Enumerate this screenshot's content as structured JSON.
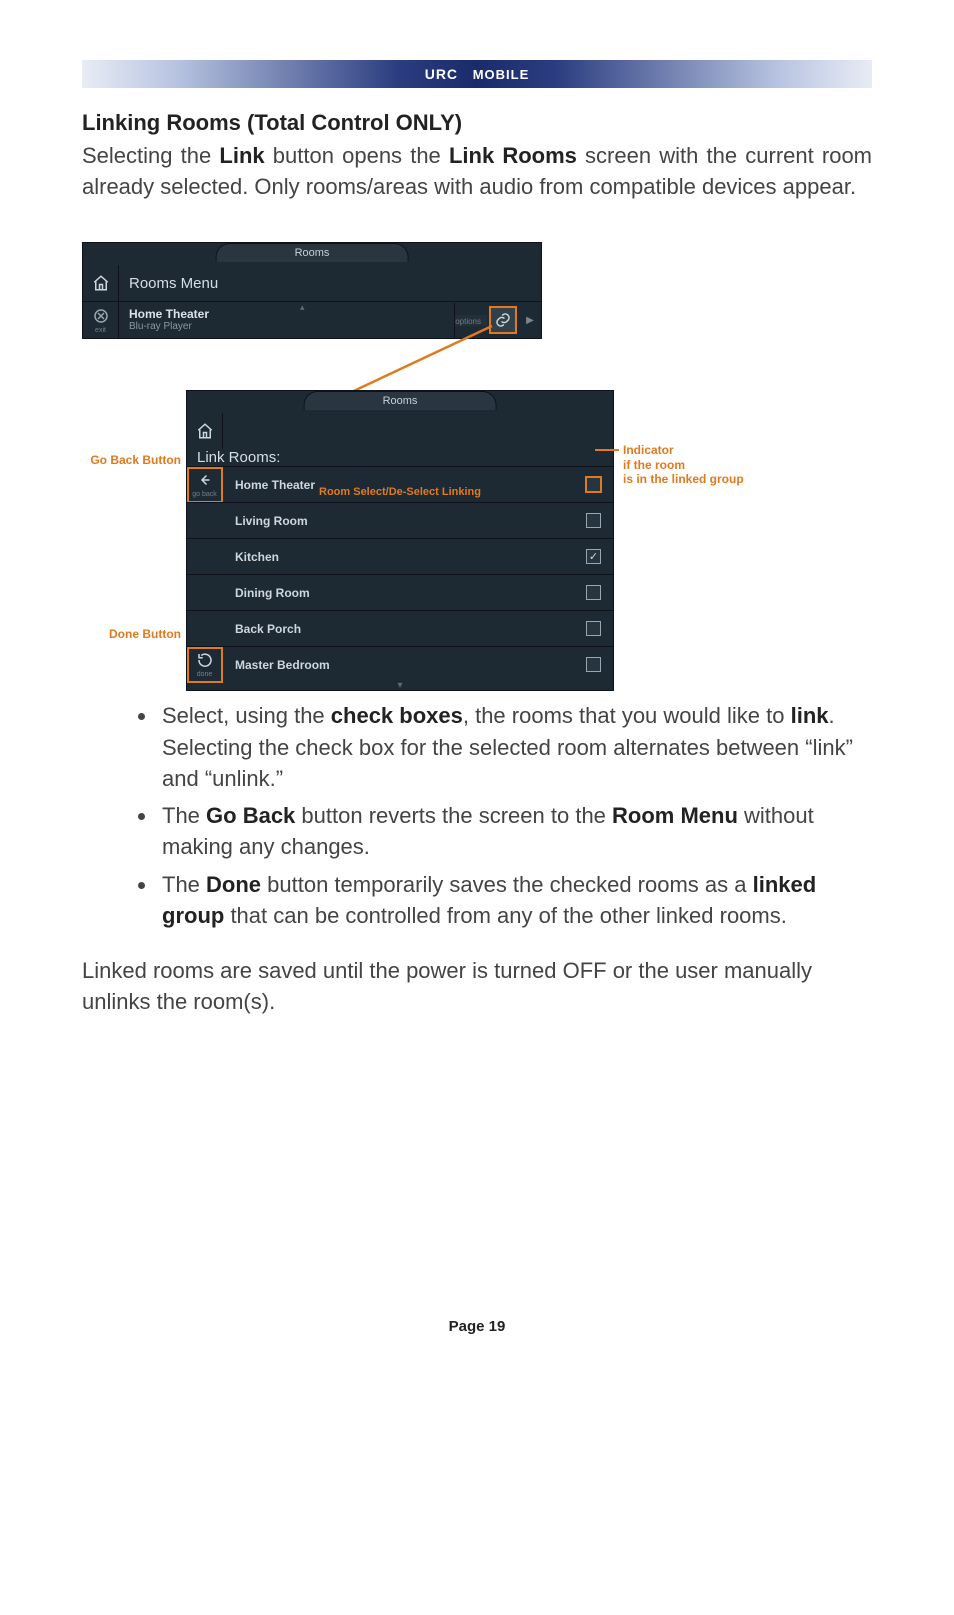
{
  "header": {
    "product": "URC",
    "product2": "MOBILE"
  },
  "section": {
    "title": "Linking Rooms (Total Control ONLY)"
  },
  "intro": {
    "pre1": "Selecting the ",
    "b1": "Link",
    "mid1": " button opens the ",
    "b2": "Link Rooms",
    "post1": " screen with the current room already selected. Only rooms/areas with audio from compatible devices appear."
  },
  "panel1": {
    "tab": "Rooms",
    "title": "Rooms Menu",
    "exit_label": "exit",
    "current_room": "Home Theater",
    "now_playing": "Blu-ray Player",
    "options_label": "options"
  },
  "panel2": {
    "tab": "Rooms",
    "title": "Link Rooms:",
    "goback_label": "go back",
    "done_label": "done",
    "rooms": [
      {
        "name": "Home Theater",
        "checked": false,
        "highlight": true
      },
      {
        "name": "Living Room",
        "checked": false,
        "highlight": false
      },
      {
        "name": "Kitchen",
        "checked": true,
        "highlight": false
      },
      {
        "name": "Dining Room",
        "checked": false,
        "highlight": false
      },
      {
        "name": "Back Porch",
        "checked": false,
        "highlight": false
      },
      {
        "name": "Master Bedroom",
        "checked": false,
        "highlight": false
      }
    ]
  },
  "callouts": {
    "go_back": "Go Back Button",
    "done": "Done Button",
    "room_select": "Room Select/De-Select Linking",
    "indicator_l1": "Indicator",
    "indicator_l2": "if the room",
    "indicator_l3": "is in the linked group"
  },
  "bullets": {
    "b1_pre": "Select, using the ",
    "b1_b1": "check boxes",
    "b1_mid": ", the rooms that you would like to ",
    "b1_b2": "link",
    "b1_post": ". Selecting the check box for the selected room alternates between “link” and “unlink.”",
    "b2_pre": "The ",
    "b2_b1": "Go Back",
    "b2_mid": " button reverts the screen to the ",
    "b2_b2": "Room Menu",
    "b2_post": " without making any changes.",
    "b3_pre": "The ",
    "b3_b1": "Done",
    "b3_mid": " button temporarily saves the checked rooms as a ",
    "b3_b2": "linked group",
    "b3_post": " that can be controlled from any of the other linked rooms."
  },
  "closing": "Linked rooms are saved until the power is turned OFF or the user manually unlinks the room(s).",
  "footer": "Page 19"
}
